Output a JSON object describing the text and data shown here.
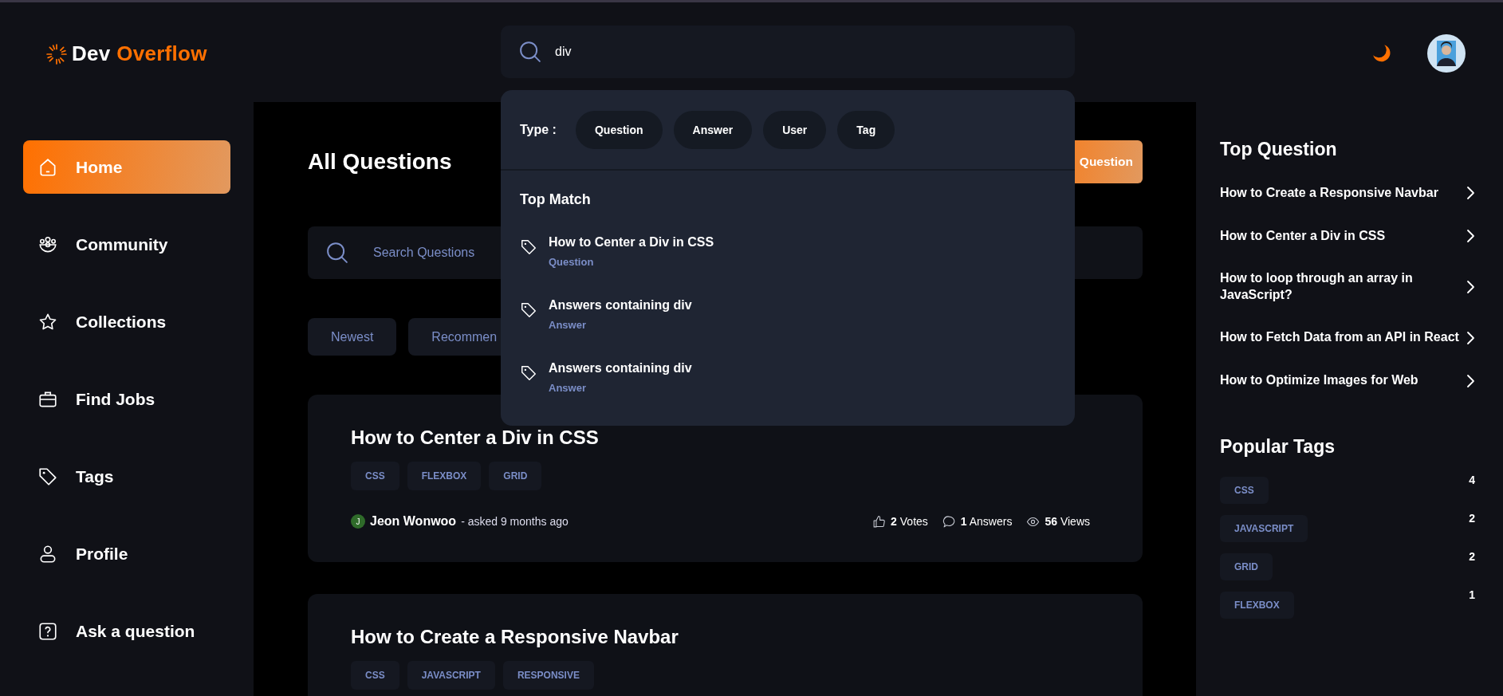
{
  "logo": {
    "first": "Dev",
    "second": "Overflow"
  },
  "search": {
    "value": "div"
  },
  "dropdown": {
    "type_label": "Type :",
    "types": [
      {
        "label": "Question",
        "selected": false
      },
      {
        "label": "Answer",
        "selected": false
      },
      {
        "label": "User",
        "selected": false
      },
      {
        "label": "Tag",
        "selected": false
      }
    ],
    "heading": "Top Match",
    "results": [
      {
        "title": "How to Center a Div in CSS",
        "kind_label": "Question"
      },
      {
        "title": "Answers containing div",
        "kind_label": "Answer"
      },
      {
        "title": "Answers containing div",
        "kind_label": "Answer"
      }
    ]
  },
  "nav": [
    {
      "label": "Home",
      "kind": "home",
      "selected": true
    },
    {
      "label": "Community",
      "kind": "community",
      "selected": false
    },
    {
      "label": "Collections",
      "kind": "star",
      "selected": false
    },
    {
      "label": "Find Jobs",
      "kind": "briefcase",
      "selected": false
    },
    {
      "label": "Tags",
      "kind": "tag",
      "selected": false
    },
    {
      "label": "Profile",
      "kind": "user",
      "selected": false
    },
    {
      "label": "Ask a question",
      "kind": "question",
      "selected": false
    }
  ],
  "main": {
    "title": "All Questions",
    "ask_button": "Question",
    "search_placeholder": "Search Questions",
    "filters": [
      {
        "label": "Newest",
        "selected": false
      },
      {
        "label": "Recommen",
        "selected": false
      }
    ],
    "questions": [
      {
        "title": "How to Center a Div in CSS",
        "tags": [
          "CSS",
          "FLEXBOX",
          "GRID"
        ],
        "author_initial": "J",
        "author": "Jeon Wonwoo",
        "asked": "- asked 9 months ago",
        "votes": "**2** Votes",
        "answers": "**1** Answers",
        "views": "**56** Views"
      },
      {
        "title": "How to Create a Responsive Navbar",
        "tags": [
          "CSS",
          "JAVASCRIPT",
          "RESPONSIVE"
        ]
      }
    ]
  },
  "right": {
    "top_title": "Top Question",
    "top_questions": [
      "How to Create a Responsive Navbar",
      "How to Center a Div in CSS",
      "How to loop through an array in JavaScript?",
      "How to Fetch Data from an API in React",
      "How to Optimize Images for Web"
    ],
    "tags_title": "Popular Tags",
    "tags": [
      {
        "name": "CSS",
        "count": "4"
      },
      {
        "name": "JAVASCRIPT",
        "count": "2"
      },
      {
        "name": "GRID",
        "count": "2"
      },
      {
        "name": "FLEXBOX",
        "count": "1"
      }
    ]
  }
}
